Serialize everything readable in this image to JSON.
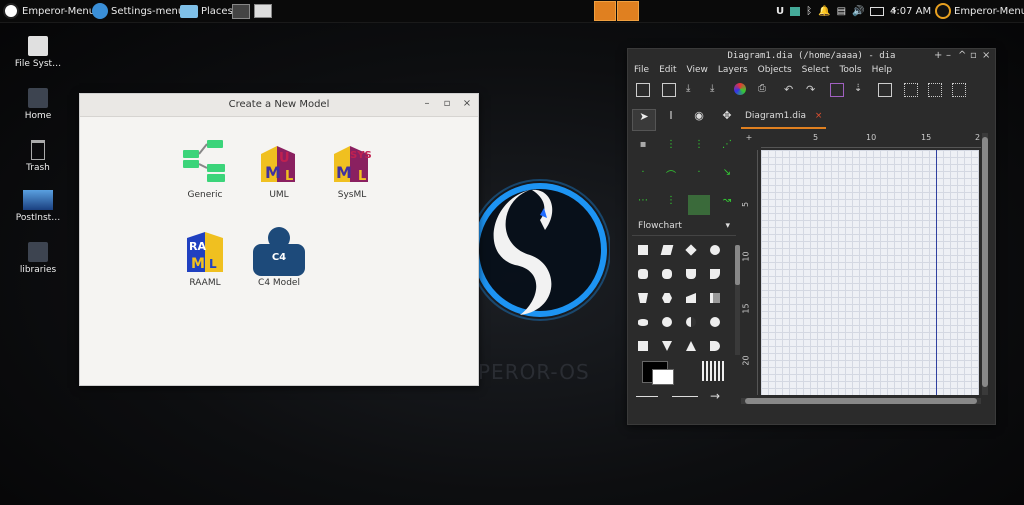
{
  "panel": {
    "menu_label": "Emperor-Menu",
    "settings_label": "Settings-menu",
    "places_label": "Places",
    "clock": "4:07 AM",
    "right_menu_label": "Emperor-Menu"
  },
  "desktop": {
    "icons": [
      {
        "label": "File Syst…"
      },
      {
        "label": "Home"
      },
      {
        "label": "Trash"
      },
      {
        "label": "PostInst…"
      },
      {
        "label": "libraries"
      }
    ]
  },
  "wallpaper": {
    "text": "PEROR-OS",
    "glow_color": "#1e9bff"
  },
  "model_dialog": {
    "title": "Create a New Model",
    "models": [
      {
        "label": "Generic",
        "icon": "generic-model-icon"
      },
      {
        "label": "UML",
        "icon": "uml-model-icon"
      },
      {
        "label": "SysML",
        "icon": "sysml-model-icon"
      },
      {
        "label": "RAAML",
        "icon": "raaml-model-icon"
      },
      {
        "label": "C4 Model",
        "icon": "c4-model-icon",
        "badge": "C4"
      }
    ]
  },
  "dia": {
    "title": "Diagram1.dia (/home/aaaa) - dia",
    "menu": [
      "File",
      "Edit",
      "View",
      "Layers",
      "Objects",
      "Select",
      "Tools",
      "Help"
    ],
    "tab_label": "Diagram1.dia",
    "sheet_selector": "Flowchart",
    "ruler_h": [
      "5",
      "10",
      "15",
      "2"
    ],
    "ruler_v": [
      "5",
      "10",
      "15",
      "20"
    ],
    "accent": "#e08020"
  }
}
